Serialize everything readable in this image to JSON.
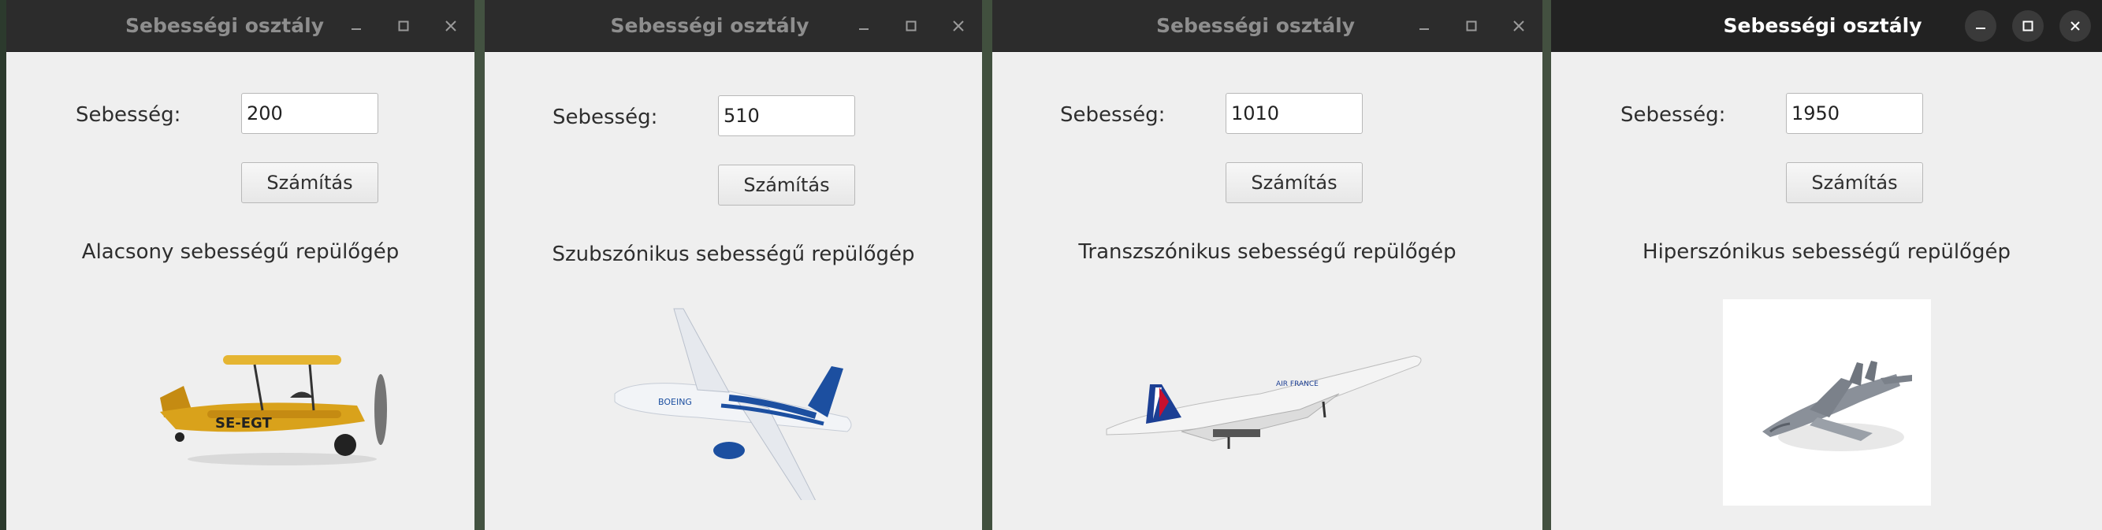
{
  "windows": [
    {
      "title": "Sebességi osztály",
      "speed_label": "Sebesség:",
      "speed_value": "200",
      "button_label": "Számítás",
      "result": "Alacsony sebességű repülőgép",
      "image_icon": "biplane-icon"
    },
    {
      "title": "Sebességi osztály",
      "speed_label": "Sebesség:",
      "speed_value": "510",
      "button_label": "Számítás",
      "result": "Szubszónikus sebességű repülőgép",
      "image_icon": "airliner-icon"
    },
    {
      "title": "Sebességi osztály",
      "speed_label": "Sebesség:",
      "speed_value": "1010",
      "button_label": "Számítás",
      "result": "Transzszónikus sebességű repülőgép",
      "image_icon": "concorde-icon"
    },
    {
      "title": "Sebességi osztály",
      "speed_label": "Sebesség:",
      "speed_value": "1950",
      "button_label": "Számítás",
      "result": "Hiperszónikus sebességű repülőgép",
      "image_icon": "fighter-jet-icon"
    }
  ],
  "colors": {
    "titlebar_inactive": "#2c2c2c",
    "titlebar_active": "#222222",
    "window_bg": "#efefef",
    "biplane": "#d9a21b",
    "airliner_stripe": "#1c4fa0",
    "concorde_tail": "#c8102e"
  }
}
